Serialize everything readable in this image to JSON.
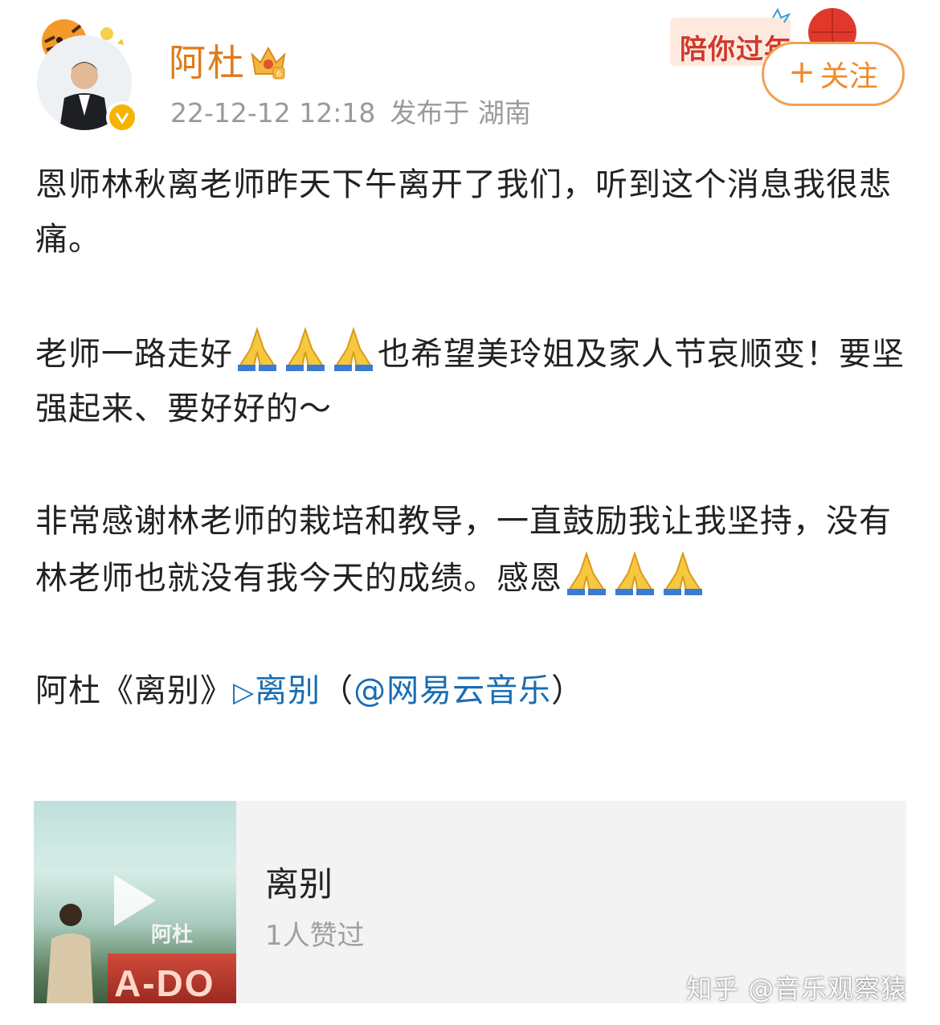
{
  "header": {
    "username": "阿杜",
    "post_time": "22-12-12 12:18",
    "location_text": "发布于 湖南",
    "follow_label": "关注",
    "banner_text": "陪你过年"
  },
  "post": {
    "paragraph1": "恩师林秋离老师昨天下午离开了我们，听到这个消息我很悲痛。",
    "p2_before": "老师一路走好",
    "p2_after": "也希望美玲姐及家人节哀顺变！要坚强起来、要好好的～",
    "p3_before": "非常感谢林老师的栽培和教导，一直鼓励我让我坚持，没有林老师也就没有我今天的成绩。感恩",
    "p4_prefix": "阿杜《离别》",
    "p4_link_play": "▷",
    "p4_link_title": "离别",
    "p4_paren_open": "（",
    "p4_mention": "@网易云音乐",
    "p4_paren_close": "）"
  },
  "music_card": {
    "title": "离别",
    "likes": "1人赞过",
    "cover_artist": "阿杜",
    "cover_logo": "A-DO"
  },
  "watermark": "知乎 @音乐观察猿",
  "colors": {
    "username": "#e07a1a",
    "link": "#1a6db3",
    "follow_border": "#f0a050",
    "meta": "#9a9a9a"
  },
  "icons": [
    "tiger-avatar-frame-icon",
    "verified-badge-icon",
    "crown-badge-icon",
    "plus-icon",
    "praying-hands-icon",
    "play-icon"
  ]
}
